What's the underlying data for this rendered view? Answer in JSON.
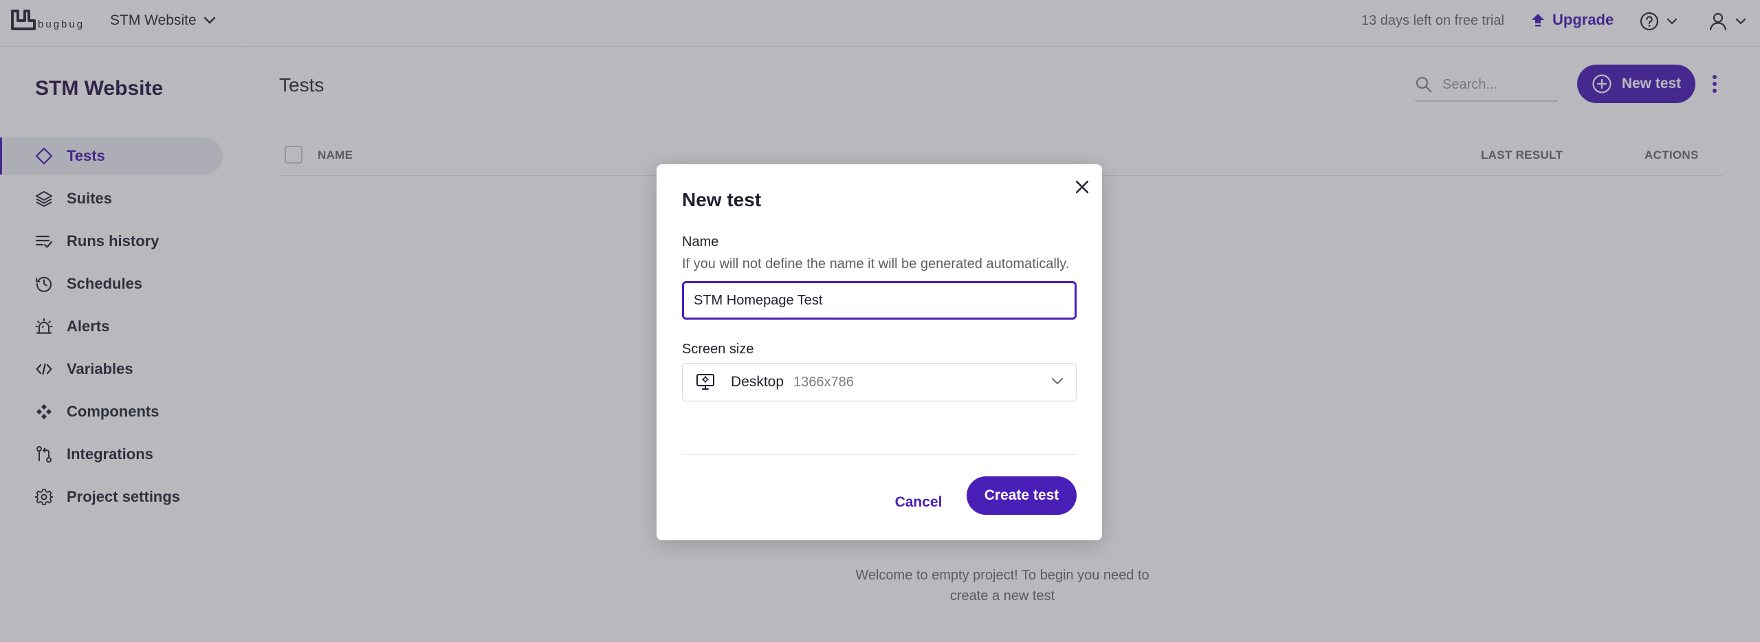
{
  "header": {
    "logo_text": "bugbug",
    "project_name": "STM Website",
    "trial_text": "13 days left on free trial",
    "upgrade_label": "Upgrade"
  },
  "sidebar": {
    "project_title": "STM Website",
    "items": [
      {
        "label": "Tests",
        "icon": "diamond-icon",
        "active": true
      },
      {
        "label": "Suites",
        "icon": "layers-icon"
      },
      {
        "label": "Runs history",
        "icon": "list-check-icon"
      },
      {
        "label": "Schedules",
        "icon": "clock-history-icon"
      },
      {
        "label": "Alerts",
        "icon": "alarm-light-icon"
      },
      {
        "label": "Variables",
        "icon": "code-icon"
      },
      {
        "label": "Components",
        "icon": "components-icon"
      },
      {
        "label": "Integrations",
        "icon": "integrations-icon"
      },
      {
        "label": "Project settings",
        "icon": "gear-icon"
      }
    ]
  },
  "main": {
    "title": "Tests",
    "search_placeholder": "Search...",
    "new_test_label": "New test",
    "columns": {
      "name": "NAME",
      "last_result": "LAST RESULT",
      "actions": "ACTIONS"
    },
    "empty_message": "Welcome to empty project! To begin you need to create a new test"
  },
  "modal": {
    "title": "New test",
    "name_label": "Name",
    "name_help": "If you will not define the name it will be generated automatically.",
    "name_value": "STM Homepage Test",
    "screen_label": "Screen size",
    "screen_value": "Desktop",
    "screen_resolution": "1366x786",
    "cancel_label": "Cancel",
    "create_label": "Create test"
  },
  "colors": {
    "accent": "#4a1fb8",
    "overlay": "rgba(60,60,72,0.36)"
  }
}
